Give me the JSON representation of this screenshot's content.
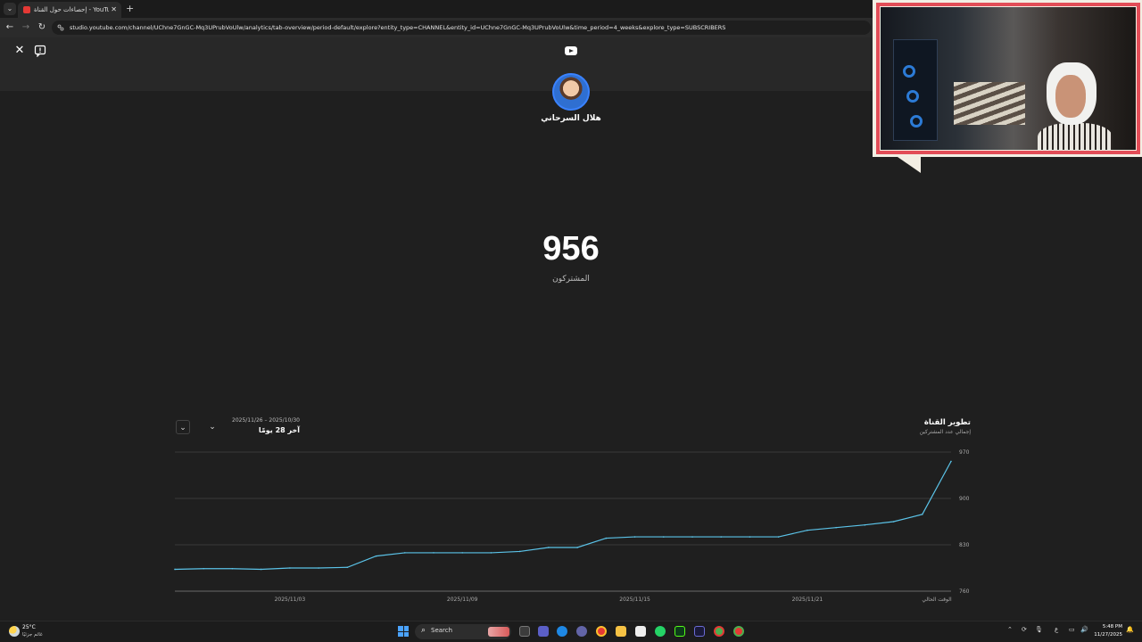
{
  "browser": {
    "tab_title": "إحصاءات حول القناة - YouTube Studio",
    "tab_new_icon": "plus-icon",
    "url": "studio.youtube.com/channel/UChne7GnGC-Mq3UPrubVoUlw/analytics/tab-overview/period-default/explore?entity_type=CHANNEL&entity_id=UChne7GnGC-Mq3UPrubVoUlw&time_period=4_weeks&explore_type=SUBSCRIBERS"
  },
  "studio": {
    "channel_name": "هلال السرحاني",
    "metric_value": "956",
    "metric_label": "المشتركون"
  },
  "chart_header": {
    "title": "تطوير القناة",
    "subtitle": "إجمالي عدد المشتركين",
    "date_range": "2025/11/26 – 2025/10/30",
    "period_label": "آخر 28 يومًا"
  },
  "chart_data": {
    "type": "line",
    "title": "تطوير القناة",
    "ylabel": "إجمالي عدد المشتركين",
    "ylim": [
      760,
      970
    ],
    "y_ticks": [
      "970",
      "900",
      "830",
      "760"
    ],
    "x_ticks": [
      "2025/11/03",
      "2025/11/09",
      "2025/11/15",
      "2025/11/21",
      "الوقت الحالي"
    ],
    "x": [
      "2025/10/30",
      "2025/10/31",
      "2025/11/01",
      "2025/11/02",
      "2025/11/03",
      "2025/11/04",
      "2025/11/05",
      "2025/11/06",
      "2025/11/07",
      "2025/11/08",
      "2025/11/09",
      "2025/11/10",
      "2025/11/11",
      "2025/11/12",
      "2025/11/13",
      "2025/11/14",
      "2025/11/15",
      "2025/11/16",
      "2025/11/17",
      "2025/11/18",
      "2025/11/19",
      "2025/11/20",
      "2025/11/21",
      "2025/11/22",
      "2025/11/23",
      "2025/11/24",
      "2025/11/25",
      "2025/11/26"
    ],
    "series": [
      {
        "color": "#5bc3e8",
        "values": [
          793,
          794,
          794,
          793,
          795,
          795,
          796,
          813,
          818,
          818,
          818,
          818,
          820,
          826,
          826,
          840,
          842,
          842,
          842,
          842,
          842,
          842,
          852,
          856,
          860,
          865,
          876,
          956
        ]
      }
    ],
    "grid": true,
    "legend": "none"
  },
  "taskbar": {
    "weather_temp": "25°C",
    "weather_desc": "غائم جزئيًا",
    "search_label": "Search",
    "time": "5:48 PM",
    "date": "11/27/2025",
    "lang": "ع"
  },
  "colors": {
    "background": "#1f1f1f",
    "header": "#282828",
    "line": "#5bc3e8",
    "accent_red": "#e24d57"
  }
}
